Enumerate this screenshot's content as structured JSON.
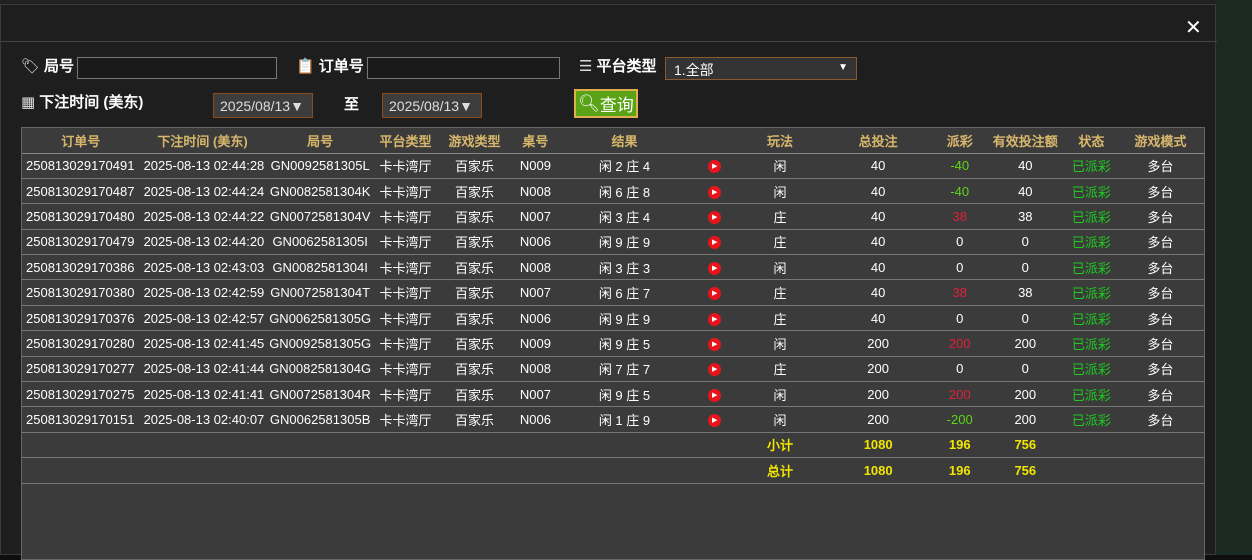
{
  "close_icon": "close-icon",
  "filters": {
    "round_label": "局号",
    "round_value": "",
    "order_label": "订单号",
    "order_value": "",
    "platform_label": "平台类型",
    "platform_value": "1.全部",
    "time_label": "下注时间 (美东)",
    "date_from": "2025/08/13",
    "to_label": "至",
    "date_to": "2025/08/13",
    "query_label": "查询"
  },
  "table": {
    "headers": [
      "订单号",
      "下注时间 (美东)",
      "局号",
      "平台类型",
      "游戏类型",
      "桌号",
      "结果",
      "",
      "玩法",
      "总投注",
      "派彩",
      "有效投注额",
      "状态",
      "游戏模式"
    ],
    "rows": [
      [
        "250813029170491",
        "2025-08-13 02:44:28",
        "GN0092581305L",
        "卡卡湾厅",
        "百家乐",
        "N009",
        "闲 2 庄 4",
        "闲",
        "40",
        "-40",
        "40",
        "已派彩",
        "多台"
      ],
      [
        "250813029170487",
        "2025-08-13 02:44:24",
        "GN0082581304K",
        "卡卡湾厅",
        "百家乐",
        "N008",
        "闲 6 庄 8",
        "闲",
        "40",
        "-40",
        "40",
        "已派彩",
        "多台"
      ],
      [
        "250813029170480",
        "2025-08-13 02:44:22",
        "GN0072581304V",
        "卡卡湾厅",
        "百家乐",
        "N007",
        "闲 3 庄 4",
        "庄",
        "40",
        "38",
        "38",
        "已派彩",
        "多台"
      ],
      [
        "250813029170479",
        "2025-08-13 02:44:20",
        "GN0062581305I",
        "卡卡湾厅",
        "百家乐",
        "N006",
        "闲 9 庄 9",
        "庄",
        "40",
        "0",
        "0",
        "已派彩",
        "多台"
      ],
      [
        "250813029170386",
        "2025-08-13 02:43:03",
        "GN0082581304I",
        "卡卡湾厅",
        "百家乐",
        "N008",
        "闲 3 庄 3",
        "闲",
        "40",
        "0",
        "0",
        "已派彩",
        "多台"
      ],
      [
        "250813029170380",
        "2025-08-13 02:42:59",
        "GN0072581304T",
        "卡卡湾厅",
        "百家乐",
        "N007",
        "闲 6 庄 7",
        "庄",
        "40",
        "38",
        "38",
        "已派彩",
        "多台"
      ],
      [
        "250813029170376",
        "2025-08-13 02:42:57",
        "GN0062581305G",
        "卡卡湾厅",
        "百家乐",
        "N006",
        "闲 9 庄 9",
        "庄",
        "40",
        "0",
        "0",
        "已派彩",
        "多台"
      ],
      [
        "250813029170280",
        "2025-08-13 02:41:45",
        "GN0092581305G",
        "卡卡湾厅",
        "百家乐",
        "N009",
        "闲 9 庄 5",
        "闲",
        "200",
        "200",
        "200",
        "已派彩",
        "多台"
      ],
      [
        "250813029170277",
        "2025-08-13 02:41:44",
        "GN0082581304G",
        "卡卡湾厅",
        "百家乐",
        "N008",
        "闲 7 庄 7",
        "庄",
        "200",
        "0",
        "0",
        "已派彩",
        "多台"
      ],
      [
        "250813029170275",
        "2025-08-13 02:41:41",
        "GN0072581304R",
        "卡卡湾厅",
        "百家乐",
        "N007",
        "闲 9 庄 5",
        "闲",
        "200",
        "200",
        "200",
        "已派彩",
        "多台"
      ],
      [
        "250813029170151",
        "2025-08-13 02:40:07",
        "GN0062581305B",
        "卡卡湾厅",
        "百家乐",
        "N006",
        "闲 1 庄 9",
        "闲",
        "200",
        "-200",
        "200",
        "已派彩",
        "多台"
      ]
    ],
    "subtotal": {
      "label": "小计",
      "total_bet": "1080",
      "payout": "196",
      "valid_bet": "756"
    },
    "total": {
      "label": "总计",
      "total_bet": "1080",
      "payout": "196",
      "valid_bet": "756"
    }
  },
  "colors": {
    "header": "#d8b76c",
    "positive_payout": "#e0203a",
    "negative_payout": "#5ed41a",
    "status": "#1ecb1e",
    "summary": "#f2e600"
  }
}
